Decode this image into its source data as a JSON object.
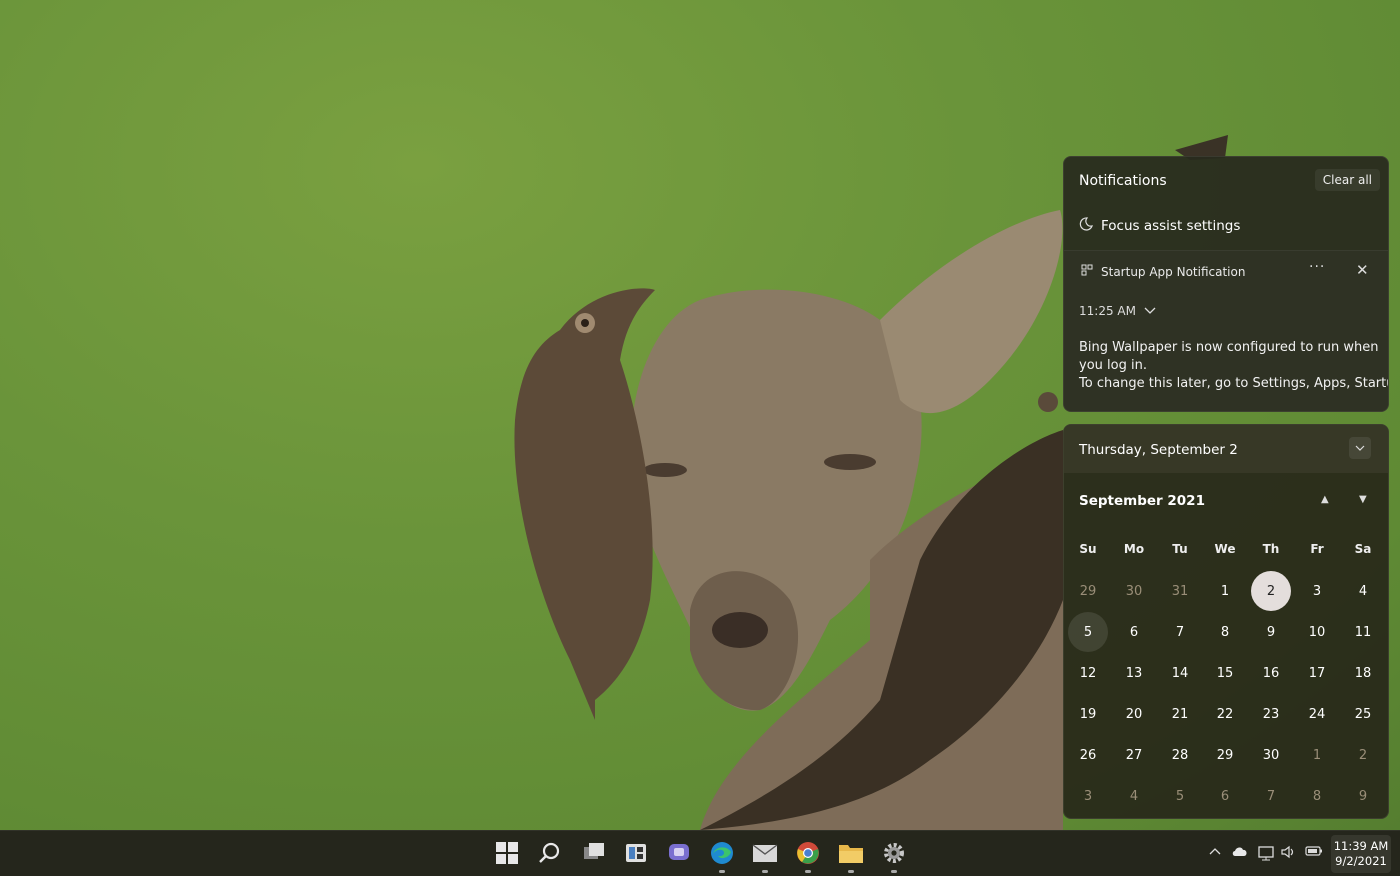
{
  "notifications": {
    "title": "Notifications",
    "clear_all": "Clear all",
    "focus_assist": "Focus assist settings",
    "toast": {
      "app_name": "Startup App Notification",
      "more": "···",
      "close": "✕",
      "time": "11:25 AM",
      "body_line1": "Bing Wallpaper is now configured to run when",
      "body_line2": "you log in.",
      "body_line3": "To change this later, go to Settings, Apps, Startup"
    }
  },
  "calendar": {
    "header_date": "Thursday, September 2",
    "month_label": "September 2021",
    "weekdays": [
      "Su",
      "Mo",
      "Tu",
      "We",
      "Th",
      "Fr",
      "Sa"
    ],
    "days": [
      {
        "d": "29",
        "muted": true
      },
      {
        "d": "30",
        "muted": true
      },
      {
        "d": "31",
        "muted": true
      },
      {
        "d": "1"
      },
      {
        "d": "2",
        "today": true
      },
      {
        "d": "3"
      },
      {
        "d": "4"
      },
      {
        "d": "5",
        "selected": true
      },
      {
        "d": "6"
      },
      {
        "d": "7"
      },
      {
        "d": "8"
      },
      {
        "d": "9"
      },
      {
        "d": "10"
      },
      {
        "d": "11"
      },
      {
        "d": "12"
      },
      {
        "d": "13"
      },
      {
        "d": "14"
      },
      {
        "d": "15"
      },
      {
        "d": "16"
      },
      {
        "d": "17"
      },
      {
        "d": "18"
      },
      {
        "d": "19"
      },
      {
        "d": "20"
      },
      {
        "d": "21"
      },
      {
        "d": "22"
      },
      {
        "d": "23"
      },
      {
        "d": "24"
      },
      {
        "d": "25"
      },
      {
        "d": "26"
      },
      {
        "d": "27"
      },
      {
        "d": "28"
      },
      {
        "d": "29"
      },
      {
        "d": "30"
      },
      {
        "d": "1",
        "muted": true
      },
      {
        "d": "2",
        "muted": true
      },
      {
        "d": "3",
        "muted": true
      },
      {
        "d": "4",
        "muted": true
      },
      {
        "d": "5",
        "muted": true
      },
      {
        "d": "6",
        "muted": true
      },
      {
        "d": "7",
        "muted": true
      },
      {
        "d": "8",
        "muted": true
      },
      {
        "d": "9",
        "muted": true
      }
    ]
  },
  "taskbar": {
    "apps": [
      "start-icon",
      "search-icon",
      "task-view-icon",
      "widgets-icon",
      "chat-icon",
      "edge-icon",
      "mail-icon",
      "chrome-icon",
      "file-explorer-icon",
      "settings-icon"
    ],
    "tray_icons": [
      "chevron-up-icon",
      "onedrive-icon",
      "network-icon",
      "volume-icon",
      "battery-icon"
    ],
    "time": "11:39 AM",
    "date": "9/2/2021"
  },
  "colors": {
    "wallpaper": "#6a943a",
    "panel": "#28291e",
    "today": "#e4dedc"
  }
}
